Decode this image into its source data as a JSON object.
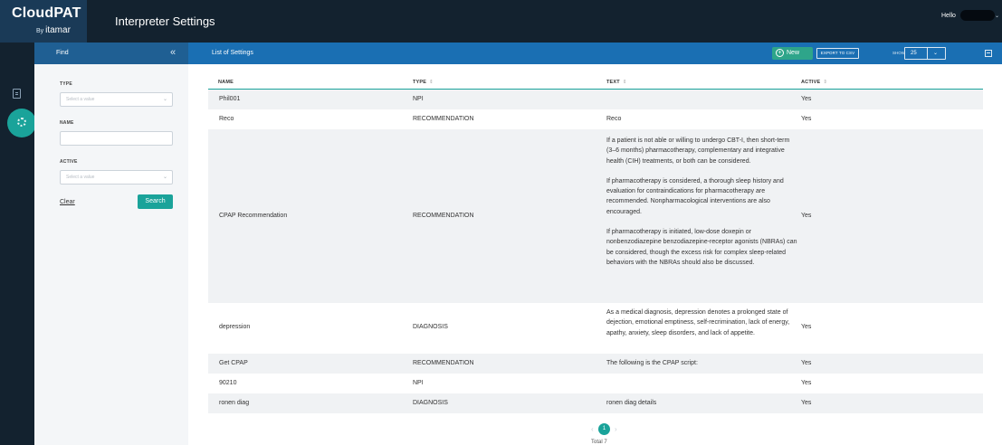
{
  "app": {
    "logo_title": "CloudPAT",
    "logo_by": "By",
    "logo_brand": "itamar",
    "page_title": "Interpreter Settings",
    "greeting": "Hello"
  },
  "find": {
    "title": "Find",
    "collapse_icon": "chevrons-left-icon",
    "type_label": "TYPE",
    "type_placeholder": "Select a value",
    "name_label": "NAME",
    "name_value": "",
    "active_label": "ACTIVE",
    "active_placeholder": "Select a value",
    "clear_label": "Clear",
    "search_label": "Search"
  },
  "list": {
    "title": "List of Settings",
    "new_label": "New",
    "export_label": "EXPORT TO CSV",
    "show_label": "SHOW",
    "show_value": "25"
  },
  "table": {
    "headers": {
      "name": "NAME",
      "type": "TYPE",
      "text": "TEXT",
      "active": "ACTIVE"
    },
    "rows": [
      {
        "name": "Phil001",
        "type": "NPI",
        "text": [],
        "active": "Yes"
      },
      {
        "name": "Reco",
        "type": "RECOMMENDATION",
        "text": [
          "Reco"
        ],
        "active": "Yes"
      },
      {
        "name": "CPAP Recommendation",
        "type": "RECOMMENDATION",
        "text": [
          "If a patient is not able or willing to undergo CBT-I, then short-term (3–6 months) pharmacotherapy, complementary and integrative health (CIH) treatments, or both can be considered.",
          "If pharmacotherapy is considered, a thorough sleep history and evaluation for contraindications for pharmacotherapy are recommended. Nonpharmacological interventions are also encouraged.",
          "If pharmacotherapy is initiated, low-dose doxepin or nonbenzodiazepine benzodiazepine-receptor agonists (NBRAs) can be considered, though the excess risk for complex sleep-related behaviors with the NBRAs should also be discussed."
        ],
        "active": "Yes"
      },
      {
        "name": "depression",
        "type": "DIAGNOSIS",
        "text": [
          "As a medical diagnosis, depression denotes a prolonged state of dejection, emotional emptiness, self-recrimination, lack of energy, apathy, anxiety, sleep disorders, and lack of appetite."
        ],
        "active": "Yes"
      },
      {
        "name": "Get CPAP",
        "type": "RECOMMENDATION",
        "text": [
          "The following is the CPAP script:"
        ],
        "active": "Yes"
      },
      {
        "name": "90210",
        "type": "NPI",
        "text": [],
        "active": "Yes"
      },
      {
        "name": "ronen diag",
        "type": "DIAGNOSIS",
        "text": [
          "ronen diag details"
        ],
        "active": "Yes"
      }
    ]
  },
  "pagination": {
    "current_page": "1",
    "total_label": "Total 7"
  }
}
